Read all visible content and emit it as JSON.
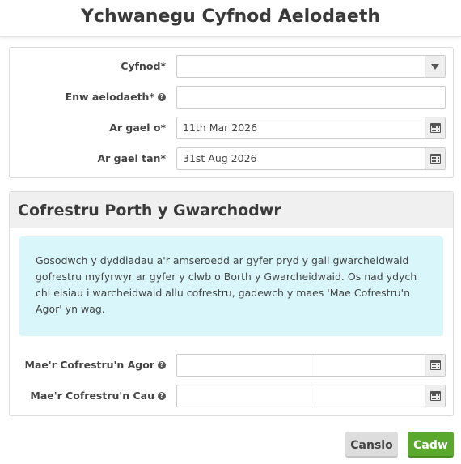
{
  "dialog": {
    "title": "Ychwanegu Cyfnod Aelodaeth"
  },
  "membership": {
    "period_label": "Cyfnod*",
    "period_value": "",
    "name_label": "Enw aelodaeth*",
    "name_value": "",
    "available_from_label": "Ar gael o*",
    "available_from_value": "11th Mar 2026",
    "available_until_label": "Ar gael tan*",
    "available_until_value": "31st Aug 2026"
  },
  "guardian_portal": {
    "heading": "Cofrestru Porth y Gwarchodwr",
    "info_text": "Gosodwch y dyddiadau a'r amseroedd ar gyfer pryd y gall gwarcheidwaid gofrestru myfyrwyr ar gyfer y clwb o Borth y Gwarcheidwaid. Os nad ydych chi eisiau i warcheidwaid allu cofrestru, gadewch y maes 'Mae Cofrestru'n Agor' yn wag.",
    "open_label": "Mae'r Cofrestru'n Agor",
    "close_label": "Mae'r Cofrestru'n Cau",
    "open_date": "",
    "open_time": "",
    "close_date": "",
    "close_time": ""
  },
  "footer": {
    "cancel_label": "Canslo",
    "save_label": "Cadw"
  },
  "icons": {
    "help": "question-circle-icon",
    "dropdown": "caret-down-icon",
    "calendar": "calendar-icon"
  },
  "colors": {
    "save_button": "#5ba82e",
    "cancel_button": "#dddddd",
    "info_background": "#d9f7fb",
    "panel_heading_background": "#f0f0f0"
  }
}
